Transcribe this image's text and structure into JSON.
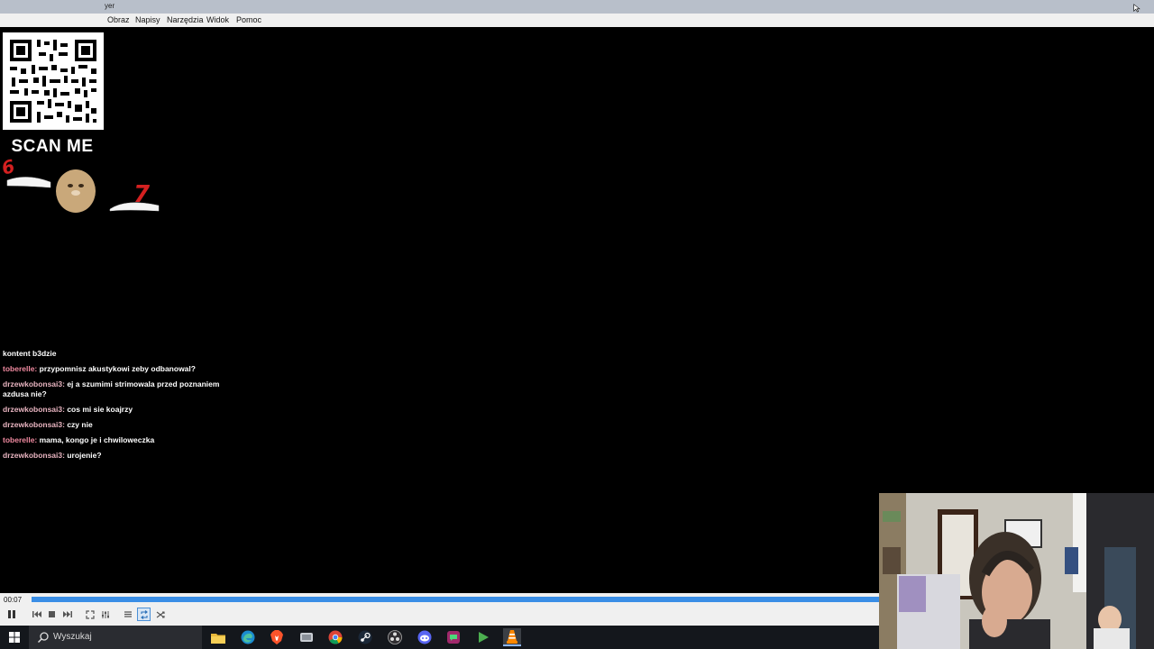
{
  "window": {
    "title": "yer"
  },
  "menu": [
    {
      "label": "Obraz",
      "x": 0
    },
    {
      "label": "Napisy"
    },
    {
      "label": "Narzędzia"
    },
    {
      "label": "Widok"
    },
    {
      "label": "Pomoc"
    }
  ],
  "overlay": {
    "qr_caption": "SCAN ME",
    "meme_left_number": "6",
    "meme_right_number": "7"
  },
  "chat": [
    {
      "user": "",
      "message": "kontent b3dzie"
    },
    {
      "user": "toberelle:",
      "message": " przypomnisz akustykowi zeby odbanowal?"
    },
    {
      "user": "drzewkobonsai3:",
      "message": " ej a szumimi strimowala przed poznaniem azdusa nie?"
    },
    {
      "user": "drzewkobonsai3:",
      "message": " cos mi sie koajrzy"
    },
    {
      "user": "drzewkobonsai3:",
      "message": " czy nie"
    },
    {
      "user": "toberelle:",
      "message": " mama, kongo je i chwiloweczka"
    },
    {
      "user": "drzewkobonsai3:",
      "message": " urojenie?"
    }
  ],
  "player": {
    "time": "00:07",
    "progress": 1.0
  },
  "taskbar": {
    "search_placeholder": "Wyszukaj"
  },
  "colors": {
    "accent": "#3a8ee6",
    "chat_user_pink": "#f08aa0",
    "chat_user_light": "#e8b4c0"
  }
}
